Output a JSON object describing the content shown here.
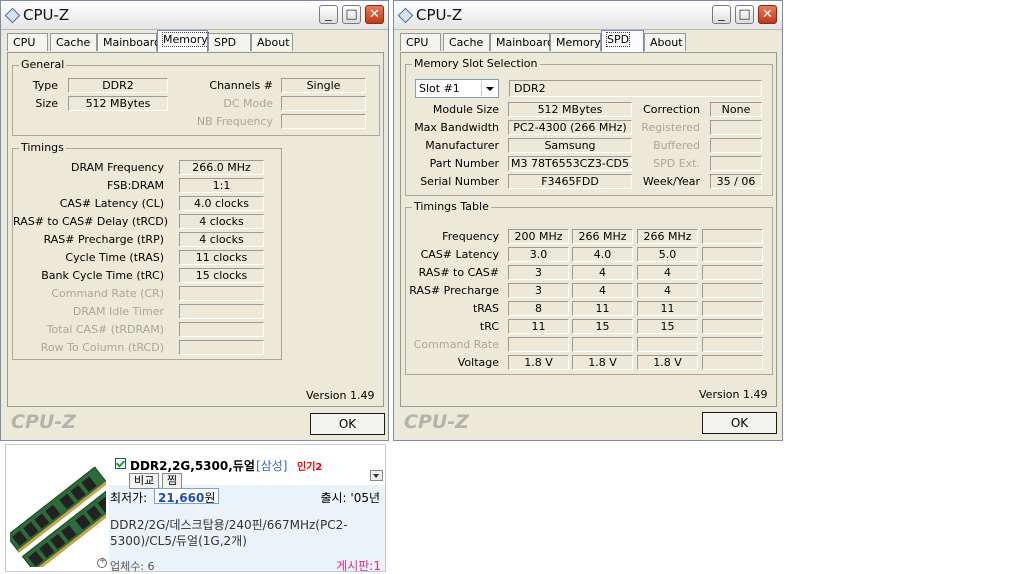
{
  "window1": {
    "title": "CPU-Z",
    "tabs": [
      "CPU",
      "Cache",
      "Mainboard",
      "Memory",
      "SPD",
      "About"
    ],
    "general": {
      "legend": "General",
      "type_label": "Type",
      "type_value": "DDR2",
      "size_label": "Size",
      "size_value": "512 MBytes",
      "channels_label": "Channels #",
      "channels_value": "Single",
      "dcmode_label": "DC Mode",
      "nbfreq_label": "NB Frequency"
    },
    "timings": {
      "legend": "Timings",
      "rows": [
        {
          "label": "DRAM Frequency",
          "value": "266.0 MHz"
        },
        {
          "label": "FSB:DRAM",
          "value": "1:1"
        },
        {
          "label": "CAS# Latency (CL)",
          "value": "4.0 clocks"
        },
        {
          "label": "RAS# to CAS# Delay (tRCD)",
          "value": "4 clocks"
        },
        {
          "label": "RAS# Precharge (tRP)",
          "value": "4 clocks"
        },
        {
          "label": "Cycle Time (tRAS)",
          "value": "11 clocks"
        },
        {
          "label": "Bank Cycle Time (tRC)",
          "value": "15 clocks"
        },
        {
          "label": "Command Rate (CR)",
          "value": ""
        },
        {
          "label": "DRAM Idle Timer",
          "value": ""
        },
        {
          "label": "Total CAS# (tRDRAM)",
          "value": ""
        },
        {
          "label": "Row To Column (tRCD)",
          "value": ""
        }
      ]
    },
    "version": "Version 1.49",
    "logo": "CPU-Z",
    "ok": "OK"
  },
  "window2": {
    "title": "CPU-Z",
    "tabs": [
      "CPU",
      "Cache",
      "Mainboard",
      "Memory",
      "SPD",
      "About"
    ],
    "slot": {
      "legend": "Memory Slot Selection",
      "selected": "Slot #1",
      "type": "DDR2"
    },
    "module": {
      "module_size_label": "Module Size",
      "module_size": "512 MBytes",
      "max_bw_label": "Max Bandwidth",
      "max_bw": "PC2-4300 (266 MHz)",
      "manufacturer_label": "Manufacturer",
      "manufacturer": "Samsung",
      "part_label": "Part Number",
      "part": "M3 78T6553CZ3-CD5",
      "serial_label": "Serial Number",
      "serial": "F3465FDD",
      "correction_label": "Correction",
      "correction": "None",
      "registered_label": "Registered",
      "buffered_label": "Buffered",
      "spd_ext_label": "SPD Ext.",
      "week_year_label": "Week/Year",
      "week_year": "35 / 06"
    },
    "timings_table": {
      "legend": "Timings Table",
      "rows": [
        {
          "label": "Frequency",
          "cells": [
            "200 MHz",
            "266 MHz",
            "266 MHz",
            ""
          ]
        },
        {
          "label": "CAS# Latency",
          "cells": [
            "3.0",
            "4.0",
            "5.0",
            ""
          ]
        },
        {
          "label": "RAS# to CAS#",
          "cells": [
            "3",
            "4",
            "4",
            ""
          ]
        },
        {
          "label": "RAS# Precharge",
          "cells": [
            "3",
            "4",
            "4",
            ""
          ]
        },
        {
          "label": "tRAS",
          "cells": [
            "8",
            "11",
            "11",
            ""
          ]
        },
        {
          "label": "tRC",
          "cells": [
            "11",
            "15",
            "15",
            ""
          ]
        },
        {
          "label": "Command Rate",
          "cells": [
            "",
            "",
            "",
            ""
          ]
        },
        {
          "label": "Voltage",
          "cells": [
            "1.8 V",
            "1.8 V",
            "1.8 V",
            ""
          ]
        }
      ]
    },
    "version": "Version 1.49",
    "logo": "CPU-Z",
    "ok": "OK"
  },
  "product": {
    "name": "DDR2,2G,5300,듀얼",
    "brand": "[삼성]",
    "badge": "인기2",
    "compare_btn": "비교",
    "save_btn": "찜",
    "price_label": "최저가:",
    "price": "21,660",
    "price_unit": "원",
    "release": "출시: '05년",
    "spec": "DDR2/2G/데스크탑용/240핀/667MHz(PC2-5300)/CL5/듀얼(1G,2개)",
    "vendors": "업체수: 6",
    "board": "게시판:1"
  },
  "colors": {
    "window_bg": "#ece9d8",
    "price": "#1b4fbf",
    "board_link": "#d6308c",
    "badge": "#e00000"
  }
}
